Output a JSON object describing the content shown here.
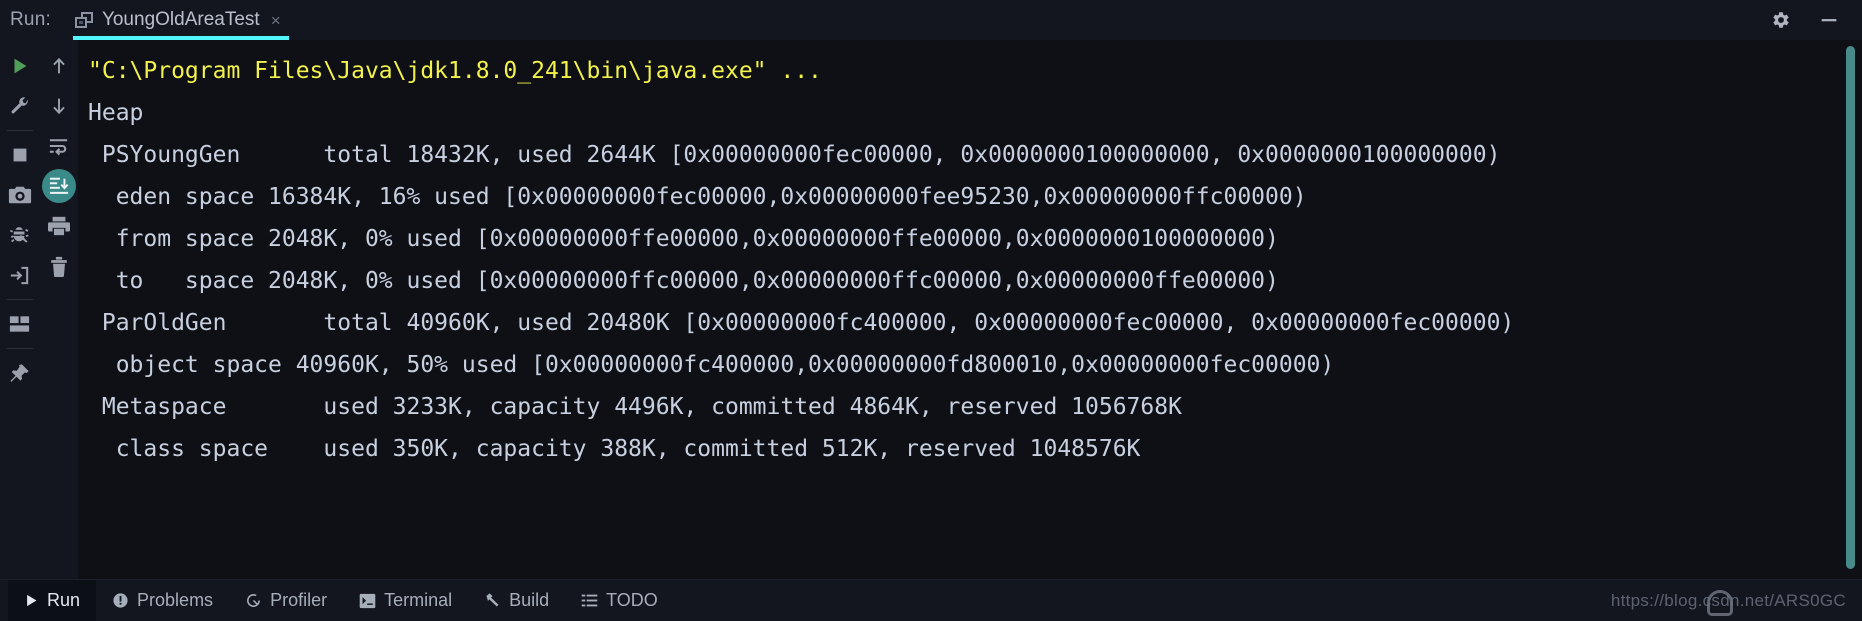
{
  "window": {
    "run_label": "Run:",
    "tab": {
      "title": "YoungOldAreaTest",
      "close": "×",
      "icon": "window-restore-icon",
      "underline_color": "#52f6ff"
    },
    "settings_icon": "gear-icon",
    "minimize_icon": "minimize-icon"
  },
  "gutter": {
    "column_left": [
      {
        "name": "rerun-button",
        "icon": "play-icon"
      },
      {
        "name": "edit-configurations-button",
        "icon": "wrench-icon"
      },
      {
        "name": "stop-button",
        "icon": "stop-square-icon"
      },
      {
        "name": "screenshot-button",
        "icon": "camera-icon"
      },
      {
        "name": "debug-button",
        "icon": "bug-icon"
      },
      {
        "name": "import-button",
        "icon": "arrow-into-box-icon"
      },
      {
        "name": "layout-button",
        "icon": "layout-panels-icon"
      },
      {
        "name": "pin-tab-button",
        "icon": "pin-icon"
      }
    ],
    "column_right": [
      {
        "name": "scroll-up-button",
        "icon": "arrow-up-icon"
      },
      {
        "name": "scroll-down-button",
        "icon": "arrow-down-icon"
      },
      {
        "name": "soft-wrap-button",
        "icon": "soft-wrap-icon"
      },
      {
        "name": "scroll-to-end-button",
        "icon": "scroll-to-end-icon",
        "active": true
      },
      {
        "name": "print-button",
        "icon": "printer-icon"
      },
      {
        "name": "clear-all-button",
        "icon": "trash-icon"
      }
    ]
  },
  "console": {
    "lines": [
      {
        "text": "\"C:\\Program Files\\Java\\jdk1.8.0_241\\bin\\java.exe\" ...",
        "style": "cmd"
      },
      {
        "text": "Heap",
        "style": "head"
      },
      {
        "text": " PSYoungGen      total 18432K, used 2644K [0x00000000fec00000, 0x0000000100000000, 0x0000000100000000)",
        "style": "out"
      },
      {
        "text": "  eden space 16384K, 16% used [0x00000000fec00000,0x00000000fee95230,0x00000000ffc00000)",
        "style": "out"
      },
      {
        "text": "  from space 2048K, 0% used [0x00000000ffe00000,0x00000000ffe00000,0x0000000100000000)",
        "style": "out"
      },
      {
        "text": "  to   space 2048K, 0% used [0x00000000ffc00000,0x00000000ffc00000,0x00000000ffe00000)",
        "style": "out"
      },
      {
        "text": " ParOldGen       total 40960K, used 20480K [0x00000000fc400000, 0x00000000fec00000, 0x00000000fec00000)",
        "style": "out"
      },
      {
        "text": "  object space 40960K, 50% used [0x00000000fc400000,0x00000000fd800010,0x00000000fec00000)",
        "style": "out"
      },
      {
        "text": " Metaspace       used 3233K, capacity 4496K, committed 4864K, reserved 1056768K",
        "style": "out"
      },
      {
        "text": "  class space    used 350K, capacity 388K, committed 512K, reserved 1048576K",
        "style": "out"
      }
    ],
    "scrollbar_color": "#478a8a"
  },
  "statusbar": {
    "items": [
      {
        "label": "Run",
        "icon": "play-icon",
        "active": true
      },
      {
        "label": "Problems",
        "icon": "problems-icon",
        "active": false
      },
      {
        "label": "Profiler",
        "icon": "profiler-icon",
        "active": false
      },
      {
        "label": "Terminal",
        "icon": "terminal-icon",
        "active": false
      },
      {
        "label": "Build",
        "icon": "hammer-icon",
        "active": false
      },
      {
        "label": "TODO",
        "icon": "todo-list-icon",
        "active": false
      }
    ],
    "watermark": "https://blog.csdn.net/ARS0GC"
  }
}
